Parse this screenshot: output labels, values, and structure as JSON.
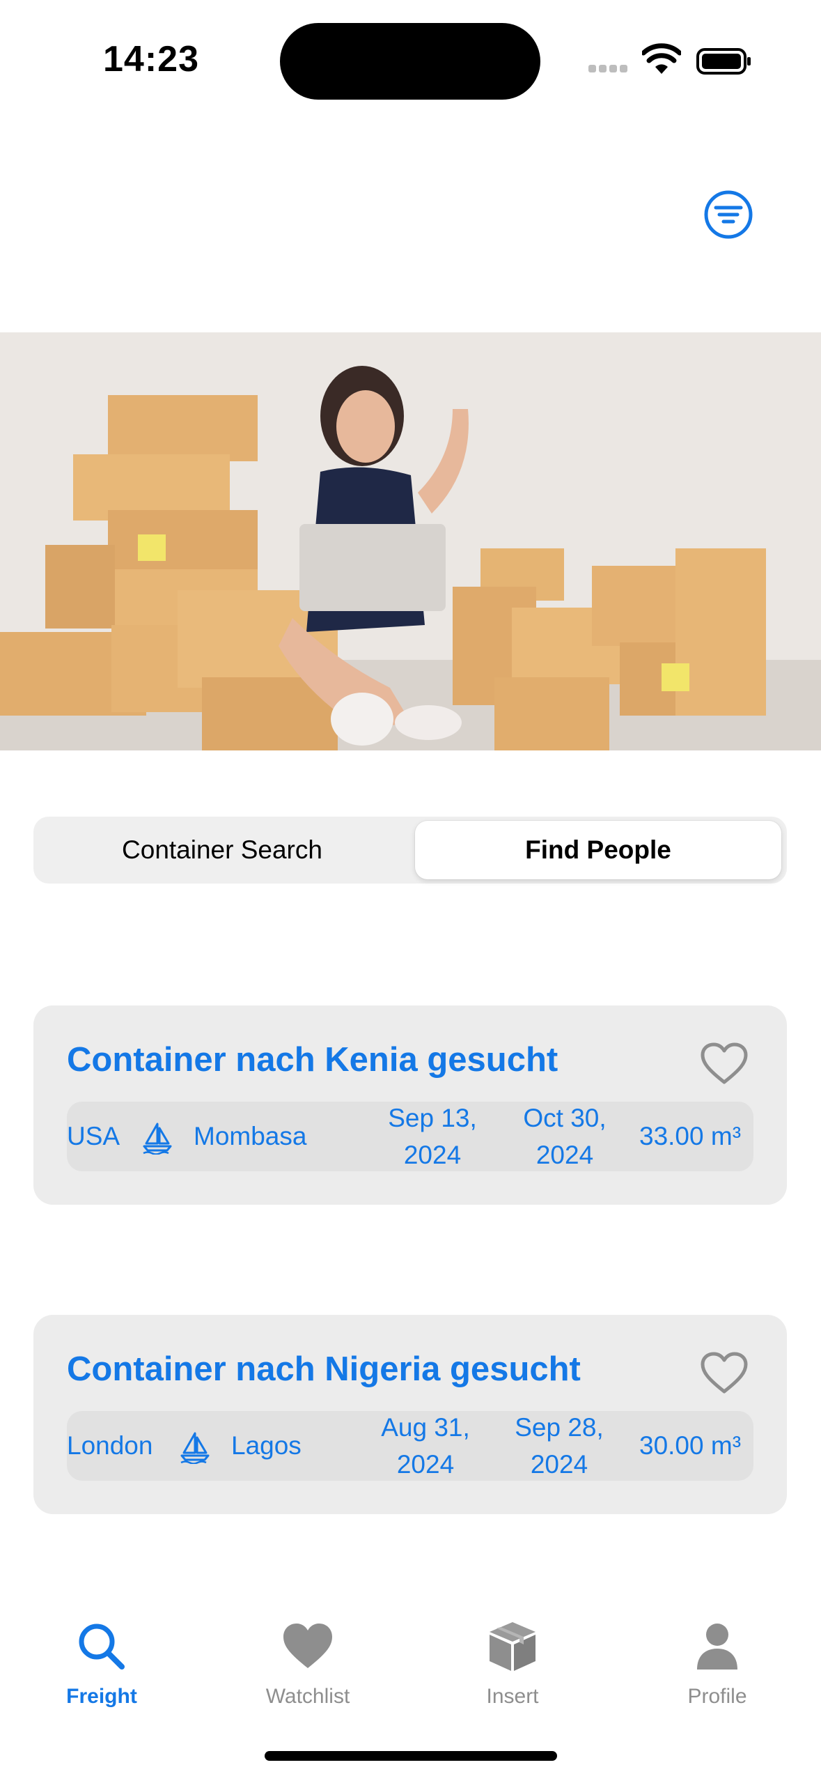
{
  "status_bar": {
    "time": "14:23"
  },
  "colors": {
    "accent": "#1478e6",
    "inactive": "#8e8e8e",
    "card_bg": "#ececec",
    "row_bg": "#e1e1e1"
  },
  "segmented": {
    "items": [
      "Container Search",
      "Find People"
    ],
    "selected": "Find People"
  },
  "cards": [
    {
      "title": "Container nach Kenia gesucht",
      "origin": "USA",
      "destination": "Mombasa",
      "start_date_line1": "Sep 13,",
      "start_date_line2": "2024",
      "end_date_line1": "Oct 30,",
      "end_date_line2": "2024",
      "volume": "33.00 m³",
      "transport_icon": "sailboat-icon",
      "favorite_icon": "heart-outline-icon"
    },
    {
      "title": "Container nach Nigeria gesucht",
      "origin": "London",
      "destination": "Lagos",
      "start_date_line1": "Aug 31,",
      "start_date_line2": "2024",
      "end_date_line1": "Sep 28,",
      "end_date_line2": "2024",
      "volume": "30.00 m³",
      "transport_icon": "sailboat-icon",
      "favorite_icon": "heart-outline-icon"
    }
  ],
  "tabbar": {
    "items": [
      {
        "label": "Freight",
        "icon": "search-icon",
        "active": true
      },
      {
        "label": "Watchlist",
        "icon": "heart-icon",
        "active": false
      },
      {
        "label": "Insert",
        "icon": "box-icon",
        "active": false
      },
      {
        "label": "Profile",
        "icon": "person-icon",
        "active": false
      }
    ]
  }
}
